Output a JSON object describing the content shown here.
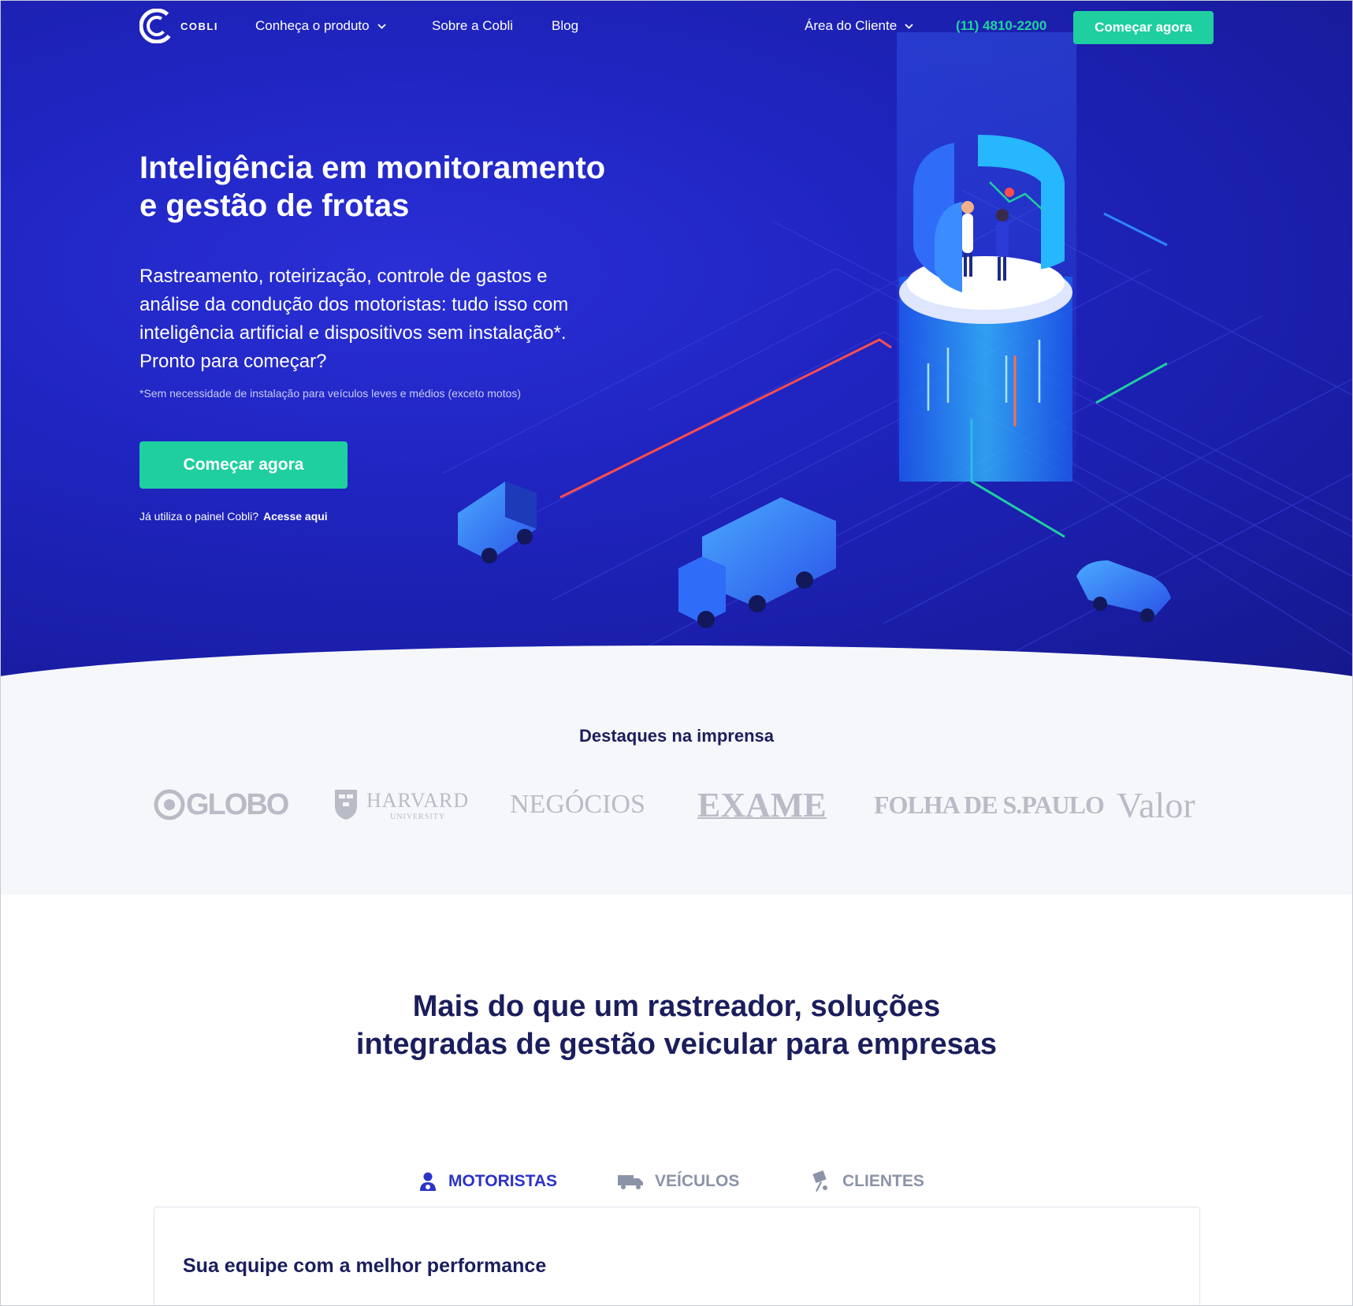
{
  "nav": {
    "logo_text": "COBLI",
    "product_menu": "Conheça o produto",
    "about": "Sobre a Cobli",
    "blog": "Blog",
    "client_area": "Área do Cliente",
    "phone": "(11) 4810-2200",
    "cta": "Começar agora"
  },
  "hero": {
    "title_line1": "Inteligência em monitoramento",
    "title_line2": "e gestão de frotas",
    "desc_line1": "Rastreamento, roteirização, controle de gastos e",
    "desc_line2": "análise da condução dos motoristas: tudo isso com",
    "desc_line3": "inteligência artificial e dispositivos sem instalação*.",
    "desc_line4": "Pronto para começar?",
    "note": "*Sem necessidade de instalação para veículos leves e médios (exceto motos)",
    "cta": "Começar agora",
    "login_text": "Já utiliza o painel Cobli?",
    "login_link": "Acesse aqui"
  },
  "press": {
    "title": "Destaques na imprensa",
    "logos": [
      "GLOBO",
      "HARVARD",
      "UNIVERSITY",
      "NEGÓCIOS",
      "EXAME",
      "FOLHA DE S.PAULO",
      "Valor"
    ]
  },
  "solutions": {
    "title_line1": "Mais do que um rastreador, soluções",
    "title_line2": "integradas de gestão veicular para empresas",
    "tabs": [
      {
        "label": "MOTORISTAS",
        "icon": "driver-icon",
        "active": true
      },
      {
        "label": "VEÍCULOS",
        "icon": "truck-icon",
        "active": false
      },
      {
        "label": "CLIENTES",
        "icon": "package-icon",
        "active": false
      }
    ],
    "card_title": "Sua equipe com a melhor performance"
  },
  "colors": {
    "hero_blue": "#2025c2",
    "accent_green": "#1fcfa0",
    "heading_navy": "#1b1e5c",
    "tab_active": "#2b33c8"
  }
}
